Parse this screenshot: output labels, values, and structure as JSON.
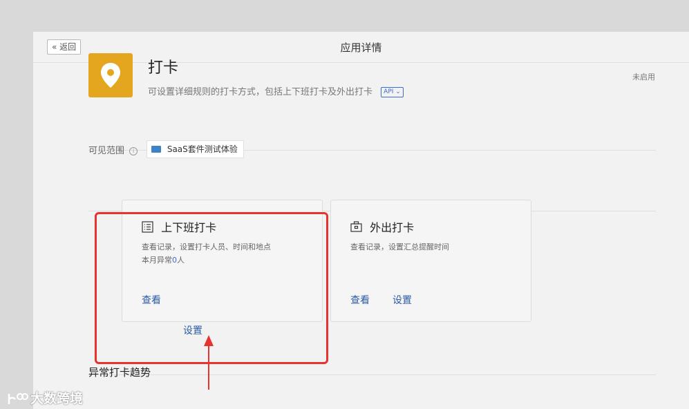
{
  "header": {
    "back_label": "« 返回",
    "title": "应用详情"
  },
  "app": {
    "name": "打卡",
    "description": "可设置详细规则的打卡方式，包括上下班打卡及外出打卡",
    "api_tag": "API ⌄",
    "icon": "location-pin-icon",
    "icon_color": "#e4a51f",
    "status": "未启用"
  },
  "scope": {
    "label": "可见范围",
    "info_glyph": "i",
    "tag": "SaaS套件测试体验"
  },
  "cards": [
    {
      "title": "上下班打卡",
      "icon": "list-icon",
      "desc_line1": "查看记录，设置打卡人员、时间和地点",
      "desc_line2_prefix": "本月异常",
      "desc_line2_count": "0",
      "desc_line2_suffix": "人",
      "view_label": "查看",
      "settings_label": "设置"
    },
    {
      "title": "外出打卡",
      "icon": "briefcase-icon",
      "desc_line1": "查看记录，设置汇总提醒时间",
      "view_label": "查看",
      "settings_label": "设置"
    }
  ],
  "trend": {
    "title": "异常打卡趋势"
  },
  "annotation": {
    "color": "#e8322e"
  },
  "watermark": {
    "text": "大数跨境"
  }
}
